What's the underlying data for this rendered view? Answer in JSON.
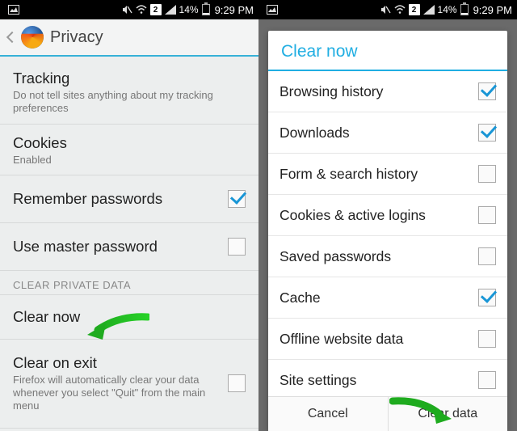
{
  "status": {
    "network_num": "2",
    "battery_pct": "14%",
    "time": "9:29 PM"
  },
  "left": {
    "title": "Privacy",
    "tracking": {
      "label": "Tracking",
      "sub": "Do not tell sites anything about my tracking preferences"
    },
    "cookies": {
      "label": "Cookies",
      "sub": "Enabled"
    },
    "remember_passwords": {
      "label": "Remember passwords",
      "checked": true
    },
    "master_password": {
      "label": "Use master password",
      "checked": false
    },
    "section_clear": "CLEAR PRIVATE DATA",
    "clear_now": {
      "label": "Clear now"
    },
    "clear_on_exit": {
      "label": "Clear on exit",
      "sub": "Firefox will automatically clear your data whenever you select \"Quit\" from the main menu",
      "checked": false
    }
  },
  "right": {
    "dialog_title": "Clear now",
    "items": [
      {
        "label": "Browsing history",
        "checked": true
      },
      {
        "label": "Downloads",
        "checked": true
      },
      {
        "label": "Form & search history",
        "checked": false
      },
      {
        "label": "Cookies & active logins",
        "checked": false
      },
      {
        "label": "Saved passwords",
        "checked": false
      },
      {
        "label": "Cache",
        "checked": true
      },
      {
        "label": "Offline website data",
        "checked": false
      },
      {
        "label": "Site settings",
        "checked": false
      }
    ],
    "buttons": {
      "cancel": "Cancel",
      "clear": "Clear data"
    }
  }
}
